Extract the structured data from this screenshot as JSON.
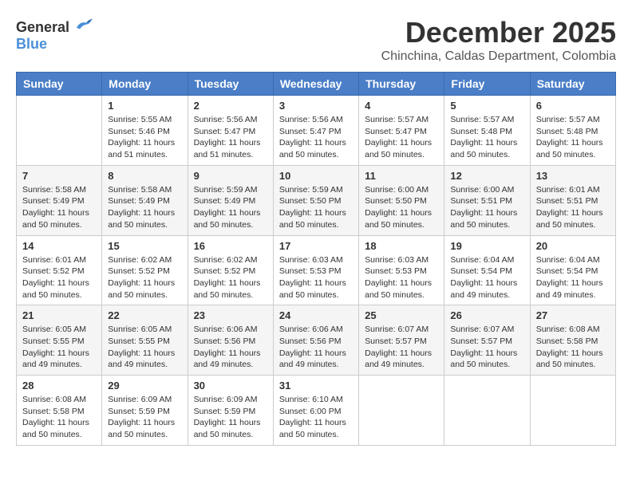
{
  "logo": {
    "general": "General",
    "blue": "Blue"
  },
  "title": "December 2025",
  "subtitle": "Chinchina, Caldas Department, Colombia",
  "weekdays": [
    "Sunday",
    "Monday",
    "Tuesday",
    "Wednesday",
    "Thursday",
    "Friday",
    "Saturday"
  ],
  "weeks": [
    [
      {
        "day": "",
        "sunrise": "",
        "sunset": "",
        "daylight": ""
      },
      {
        "day": "1",
        "sunrise": "Sunrise: 5:55 AM",
        "sunset": "Sunset: 5:46 PM",
        "daylight": "Daylight: 11 hours and 51 minutes."
      },
      {
        "day": "2",
        "sunrise": "Sunrise: 5:56 AM",
        "sunset": "Sunset: 5:47 PM",
        "daylight": "Daylight: 11 hours and 51 minutes."
      },
      {
        "day": "3",
        "sunrise": "Sunrise: 5:56 AM",
        "sunset": "Sunset: 5:47 PM",
        "daylight": "Daylight: 11 hours and 50 minutes."
      },
      {
        "day": "4",
        "sunrise": "Sunrise: 5:57 AM",
        "sunset": "Sunset: 5:47 PM",
        "daylight": "Daylight: 11 hours and 50 minutes."
      },
      {
        "day": "5",
        "sunrise": "Sunrise: 5:57 AM",
        "sunset": "Sunset: 5:48 PM",
        "daylight": "Daylight: 11 hours and 50 minutes."
      },
      {
        "day": "6",
        "sunrise": "Sunrise: 5:57 AM",
        "sunset": "Sunset: 5:48 PM",
        "daylight": "Daylight: 11 hours and 50 minutes."
      }
    ],
    [
      {
        "day": "7",
        "sunrise": "Sunrise: 5:58 AM",
        "sunset": "Sunset: 5:49 PM",
        "daylight": "Daylight: 11 hours and 50 minutes."
      },
      {
        "day": "8",
        "sunrise": "Sunrise: 5:58 AM",
        "sunset": "Sunset: 5:49 PM",
        "daylight": "Daylight: 11 hours and 50 minutes."
      },
      {
        "day": "9",
        "sunrise": "Sunrise: 5:59 AM",
        "sunset": "Sunset: 5:49 PM",
        "daylight": "Daylight: 11 hours and 50 minutes."
      },
      {
        "day": "10",
        "sunrise": "Sunrise: 5:59 AM",
        "sunset": "Sunset: 5:50 PM",
        "daylight": "Daylight: 11 hours and 50 minutes."
      },
      {
        "day": "11",
        "sunrise": "Sunrise: 6:00 AM",
        "sunset": "Sunset: 5:50 PM",
        "daylight": "Daylight: 11 hours and 50 minutes."
      },
      {
        "day": "12",
        "sunrise": "Sunrise: 6:00 AM",
        "sunset": "Sunset: 5:51 PM",
        "daylight": "Daylight: 11 hours and 50 minutes."
      },
      {
        "day": "13",
        "sunrise": "Sunrise: 6:01 AM",
        "sunset": "Sunset: 5:51 PM",
        "daylight": "Daylight: 11 hours and 50 minutes."
      }
    ],
    [
      {
        "day": "14",
        "sunrise": "Sunrise: 6:01 AM",
        "sunset": "Sunset: 5:52 PM",
        "daylight": "Daylight: 11 hours and 50 minutes."
      },
      {
        "day": "15",
        "sunrise": "Sunrise: 6:02 AM",
        "sunset": "Sunset: 5:52 PM",
        "daylight": "Daylight: 11 hours and 50 minutes."
      },
      {
        "day": "16",
        "sunrise": "Sunrise: 6:02 AM",
        "sunset": "Sunset: 5:52 PM",
        "daylight": "Daylight: 11 hours and 50 minutes."
      },
      {
        "day": "17",
        "sunrise": "Sunrise: 6:03 AM",
        "sunset": "Sunset: 5:53 PM",
        "daylight": "Daylight: 11 hours and 50 minutes."
      },
      {
        "day": "18",
        "sunrise": "Sunrise: 6:03 AM",
        "sunset": "Sunset: 5:53 PM",
        "daylight": "Daylight: 11 hours and 50 minutes."
      },
      {
        "day": "19",
        "sunrise": "Sunrise: 6:04 AM",
        "sunset": "Sunset: 5:54 PM",
        "daylight": "Daylight: 11 hours and 49 minutes."
      },
      {
        "day": "20",
        "sunrise": "Sunrise: 6:04 AM",
        "sunset": "Sunset: 5:54 PM",
        "daylight": "Daylight: 11 hours and 49 minutes."
      }
    ],
    [
      {
        "day": "21",
        "sunrise": "Sunrise: 6:05 AM",
        "sunset": "Sunset: 5:55 PM",
        "daylight": "Daylight: 11 hours and 49 minutes."
      },
      {
        "day": "22",
        "sunrise": "Sunrise: 6:05 AM",
        "sunset": "Sunset: 5:55 PM",
        "daylight": "Daylight: 11 hours and 49 minutes."
      },
      {
        "day": "23",
        "sunrise": "Sunrise: 6:06 AM",
        "sunset": "Sunset: 5:56 PM",
        "daylight": "Daylight: 11 hours and 49 minutes."
      },
      {
        "day": "24",
        "sunrise": "Sunrise: 6:06 AM",
        "sunset": "Sunset: 5:56 PM",
        "daylight": "Daylight: 11 hours and 49 minutes."
      },
      {
        "day": "25",
        "sunrise": "Sunrise: 6:07 AM",
        "sunset": "Sunset: 5:57 PM",
        "daylight": "Daylight: 11 hours and 49 minutes."
      },
      {
        "day": "26",
        "sunrise": "Sunrise: 6:07 AM",
        "sunset": "Sunset: 5:57 PM",
        "daylight": "Daylight: 11 hours and 50 minutes."
      },
      {
        "day": "27",
        "sunrise": "Sunrise: 6:08 AM",
        "sunset": "Sunset: 5:58 PM",
        "daylight": "Daylight: 11 hours and 50 minutes."
      }
    ],
    [
      {
        "day": "28",
        "sunrise": "Sunrise: 6:08 AM",
        "sunset": "Sunset: 5:58 PM",
        "daylight": "Daylight: 11 hours and 50 minutes."
      },
      {
        "day": "29",
        "sunrise": "Sunrise: 6:09 AM",
        "sunset": "Sunset: 5:59 PM",
        "daylight": "Daylight: 11 hours and 50 minutes."
      },
      {
        "day": "30",
        "sunrise": "Sunrise: 6:09 AM",
        "sunset": "Sunset: 5:59 PM",
        "daylight": "Daylight: 11 hours and 50 minutes."
      },
      {
        "day": "31",
        "sunrise": "Sunrise: 6:10 AM",
        "sunset": "Sunset: 6:00 PM",
        "daylight": "Daylight: 11 hours and 50 minutes."
      },
      {
        "day": "",
        "sunrise": "",
        "sunset": "",
        "daylight": ""
      },
      {
        "day": "",
        "sunrise": "",
        "sunset": "",
        "daylight": ""
      },
      {
        "day": "",
        "sunrise": "",
        "sunset": "",
        "daylight": ""
      }
    ]
  ],
  "row_classes": [
    "row-odd",
    "row-even",
    "row-odd",
    "row-even",
    "row-odd"
  ]
}
